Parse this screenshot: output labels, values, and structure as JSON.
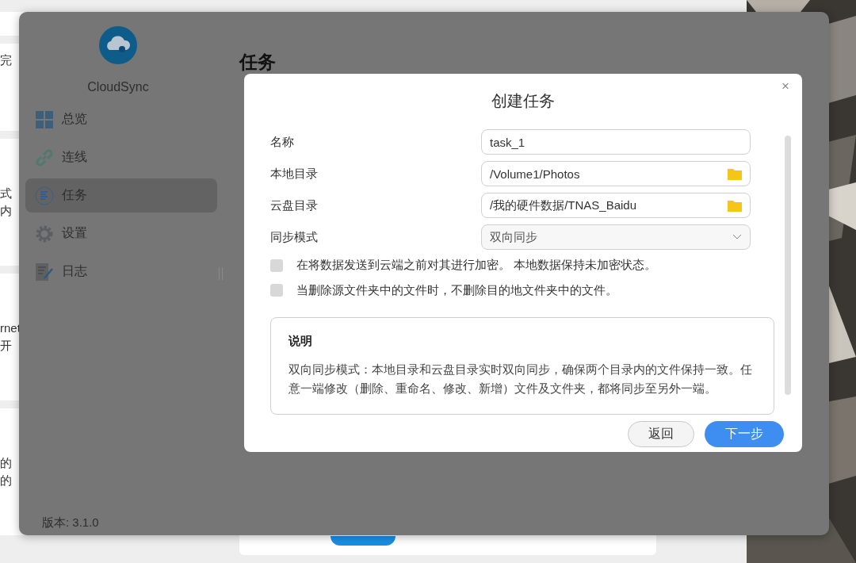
{
  "background_cards": [
    {
      "lines": [
        "完"
      ]
    },
    {
      "lines": [
        "式",
        "内"
      ]
    },
    {
      "lines": [
        "rnet",
        "开"
      ]
    },
    {
      "lines": [
        "的",
        "的"
      ]
    }
  ],
  "window": {
    "app_name": "CloudSync",
    "version": "版本: 3.1.0",
    "page_title": "任务"
  },
  "sidebar": {
    "items": [
      {
        "label": "总览",
        "selected": false
      },
      {
        "label": "连线",
        "selected": false
      },
      {
        "label": "任务",
        "selected": true
      },
      {
        "label": "设置",
        "selected": false
      },
      {
        "label": "日志",
        "selected": false
      }
    ]
  },
  "dialog": {
    "title": "创建任务",
    "close": "×",
    "fields": [
      {
        "label": "名称",
        "value": "task_1",
        "kind": "text"
      },
      {
        "label": "本地目录",
        "value": "/Volume1/Photos",
        "kind": "folder"
      },
      {
        "label": "云盘目录",
        "value": "/我的硬件数据/TNAS_Baidu",
        "kind": "folder"
      },
      {
        "label": "同步模式",
        "value": "双向同步",
        "kind": "select"
      }
    ],
    "options": [
      {
        "label": "在将数据发送到云端之前对其进行加密。 本地数据保持未加密状态。",
        "checked": false
      },
      {
        "label": "当删除源文件夹中的文件时，不删除目的地文件夹中的文件。",
        "checked": false
      }
    ],
    "note": {
      "title": "说明",
      "text": "双向同步模式：本地目录和云盘目录实时双向同步，确保两个目录内的文件保持一致。任意一端修改（删除、重命名、修改、新增）文件及文件夹，都将同步至另外一端。"
    },
    "buttons": [
      {
        "label": "返回",
        "kind": "secondary"
      },
      {
        "label": "下一步",
        "kind": "primary"
      }
    ]
  }
}
